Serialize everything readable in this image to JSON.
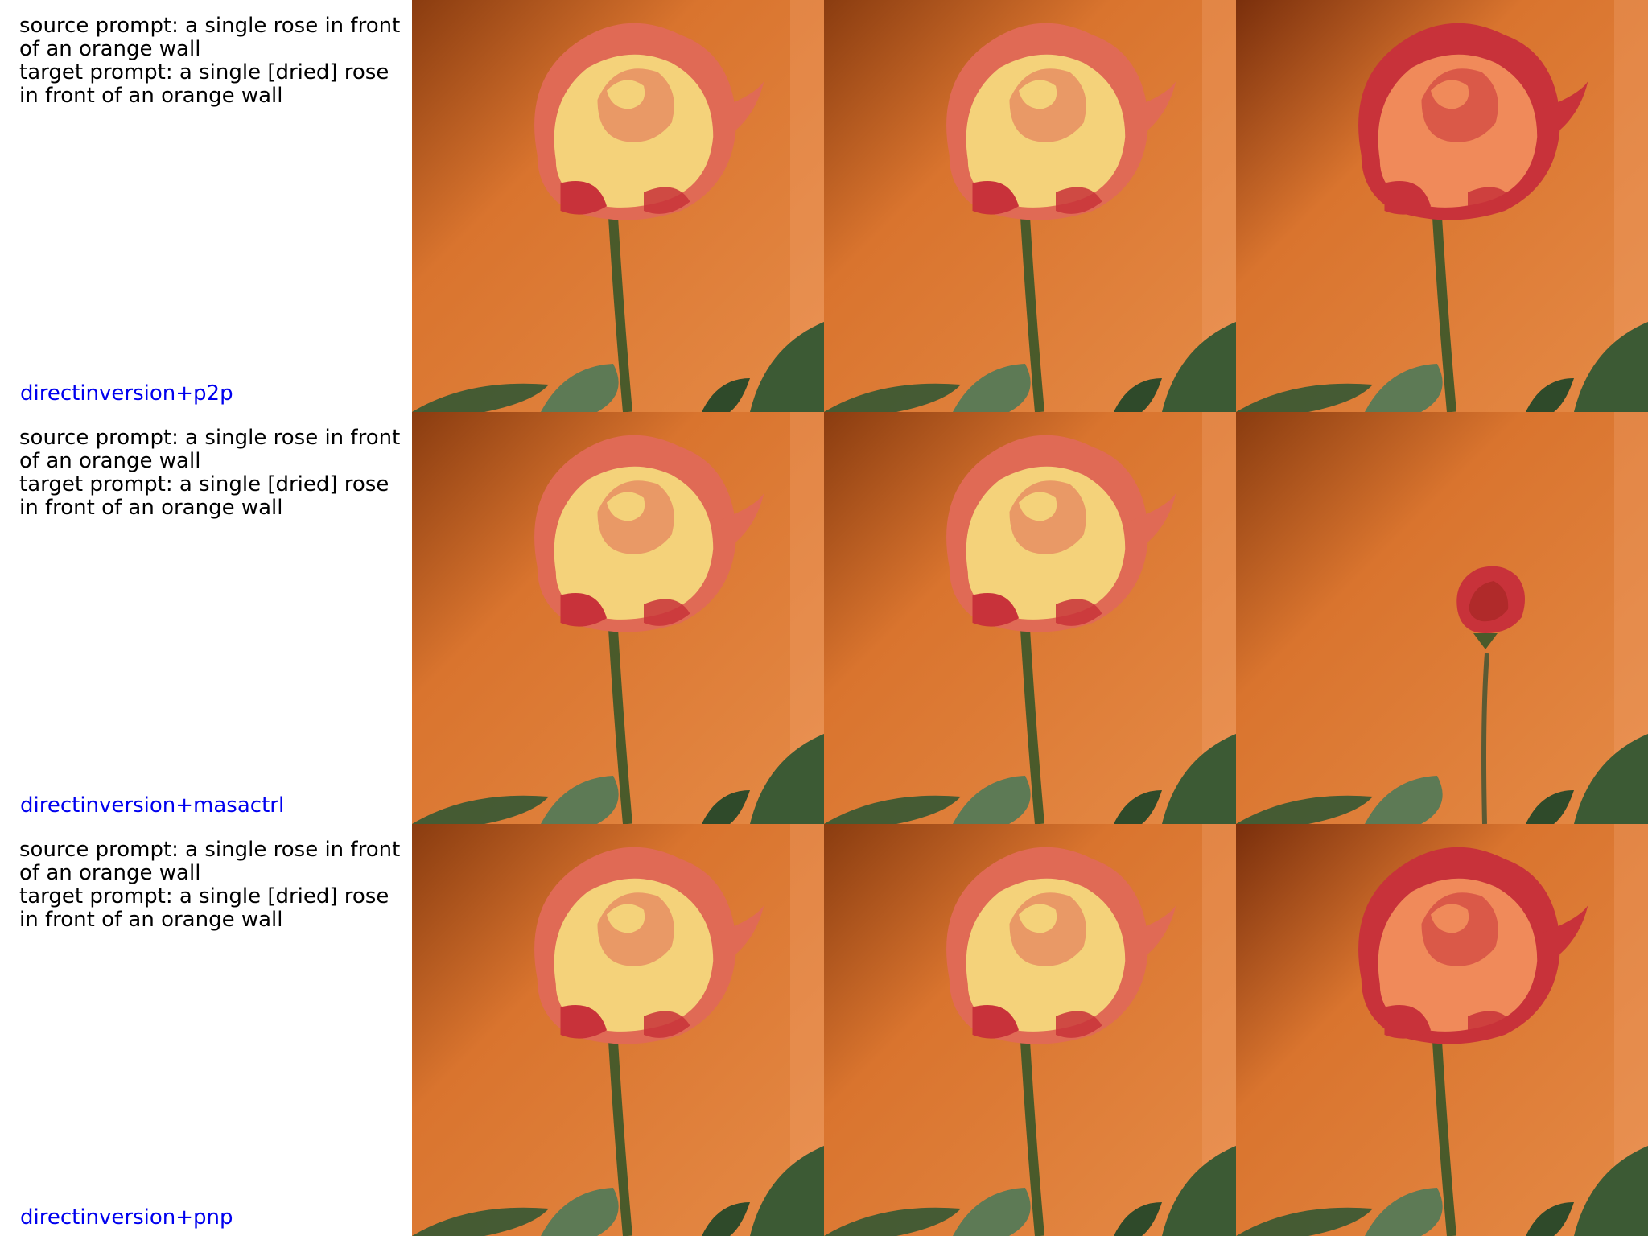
{
  "rows": [
    {
      "source_prompt": "source prompt: a single rose in front of an orange wall",
      "target_prompt": "target prompt: a single [dried] rose in front of an orange wall",
      "method": "directinversion+p2p"
    },
    {
      "source_prompt": "source prompt: a single rose in front of an orange wall",
      "target_prompt": "target prompt: a single [dried] rose in front of an orange wall",
      "method": "directinversion+masactrl"
    },
    {
      "source_prompt": "source prompt: a single rose in front of an orange wall",
      "target_prompt": "target prompt: a single [dried] rose in front of an orange wall",
      "method": "directinversion+pnp"
    }
  ],
  "colors": {
    "method_label": "#0000ee",
    "wall_orange": "#d9742e",
    "wall_shadow": "#8a3c10",
    "petal_yellow": "#f4d27a",
    "petal_red": "#c8323a",
    "stem_green": "#4a5a2a",
    "leaf_green": "#3c5a34"
  },
  "images": [
    [
      "rose-photo",
      "rose-photo",
      "rose-photo-edited"
    ],
    [
      "rose-photo",
      "rose-photo",
      "rose-photo-small-bud"
    ],
    [
      "rose-photo",
      "rose-photo",
      "rose-photo-edited"
    ]
  ]
}
